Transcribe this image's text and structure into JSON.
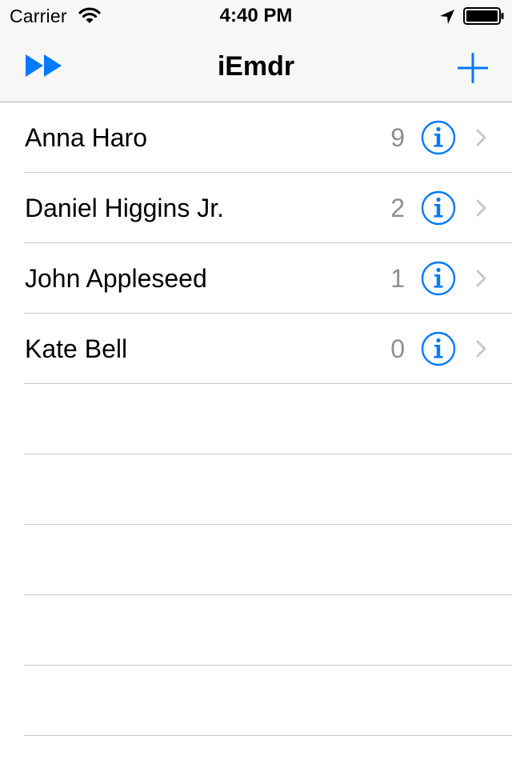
{
  "status_bar": {
    "carrier": "Carrier",
    "time": "4:40 PM",
    "icons": [
      "wifi-icon",
      "location-arrow-icon",
      "battery-icon"
    ]
  },
  "nav_bar": {
    "title": "iEmdr",
    "left_icon": "fast-forward-icon",
    "right_icon": "plus-icon"
  },
  "colors": {
    "accent": "#007aff",
    "secondary_text": "#8e8e93",
    "chevron": "#c7c7cc",
    "separator": "#c8c7cc",
    "bar_background": "#f7f7f7"
  },
  "rows": [
    {
      "name": "Anna Haro",
      "count": "9"
    },
    {
      "name": "Daniel Higgins Jr.",
      "count": "2"
    },
    {
      "name": "John Appleseed",
      "count": "1"
    },
    {
      "name": "Kate Bell",
      "count": "0"
    }
  ]
}
